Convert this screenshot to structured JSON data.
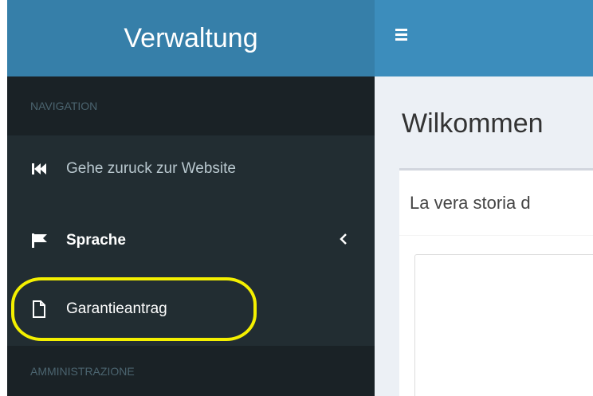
{
  "header": {
    "brand_title": "Verwaltung",
    "menu_toggle_icon": "hamburger-icon"
  },
  "sidebar": {
    "navigation_header": "NAVIGATION",
    "items": [
      {
        "label": "Gehe zuruck zur Website",
        "icon": "fast-backward-icon"
      },
      {
        "label": "Sprache",
        "icon": "flag-icon",
        "has_submenu": true,
        "submenu_icon": "chevron-left-icon"
      },
      {
        "label": "Garantieantrag",
        "icon": "file-icon",
        "highlighted": true
      }
    ],
    "admin_header": "AMMINISTRAZIONE"
  },
  "main": {
    "page_title": "Wilkommen",
    "box_title": "La vera storia d"
  },
  "colors": {
    "brand_bg": "#367fa9",
    "topbar_bg": "#3c8dbc",
    "sidebar_bg": "#222d32",
    "sidebar_header_bg": "#1a2226",
    "content_bg": "#ecf0f5",
    "highlight": "#f4f000"
  }
}
